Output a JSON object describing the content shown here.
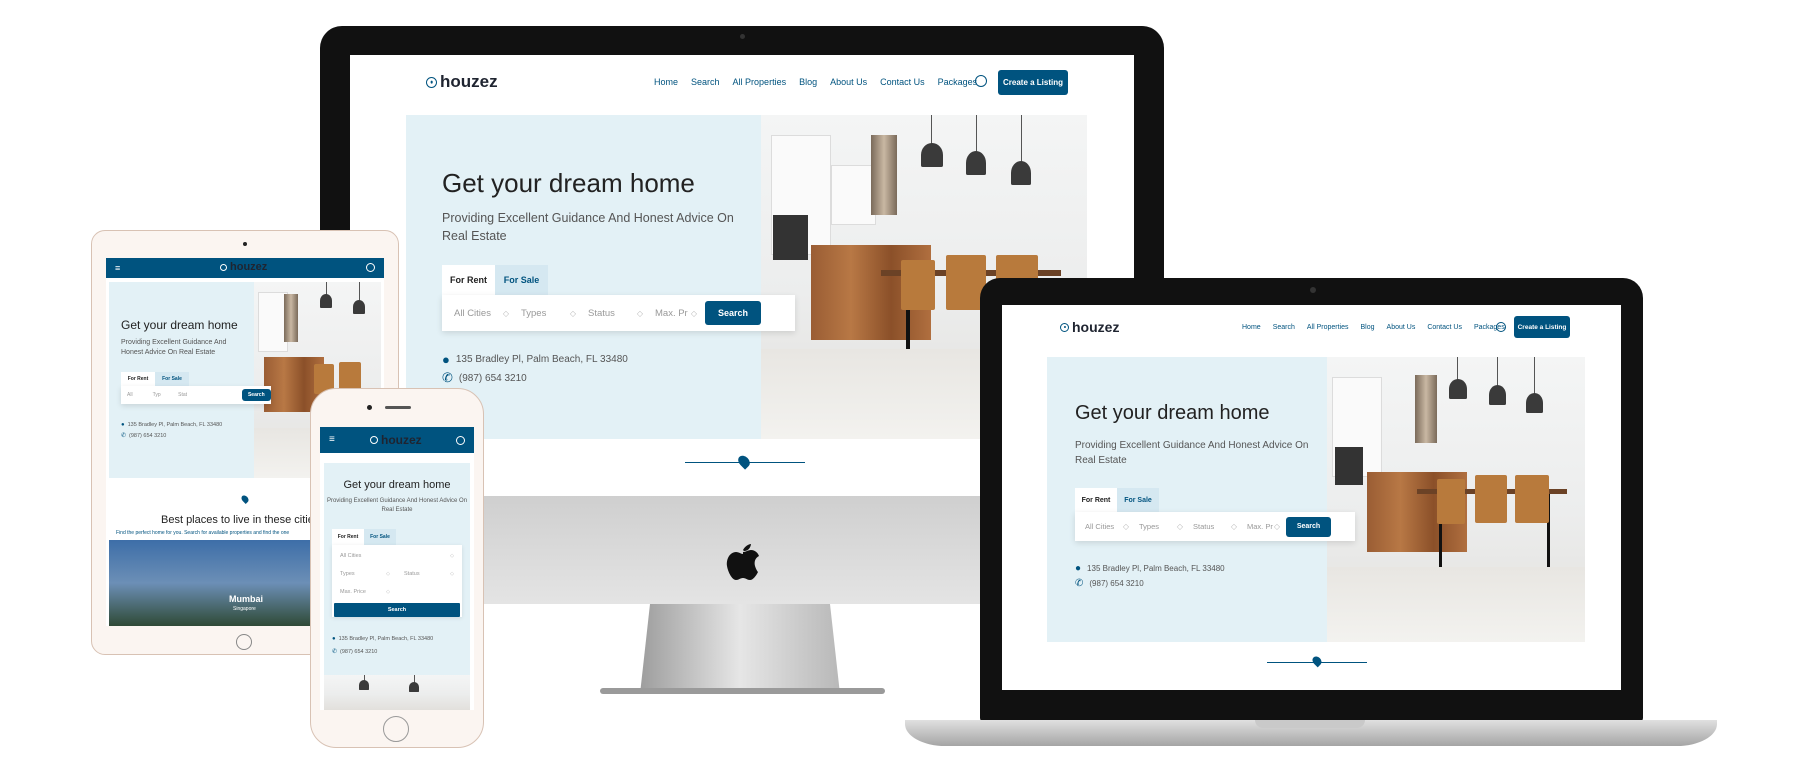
{
  "brand": "houzez",
  "nav": [
    "Home",
    "Search",
    "All Properties",
    "Blog",
    "About Us",
    "Contact Us",
    "Packages"
  ],
  "cta": "Create a Listing",
  "hero": {
    "title": "Get your dream home",
    "subtitle": "Providing Excellent Guidance And Honest Advice On Real Estate",
    "tabs": [
      "For Rent",
      "For Sale"
    ],
    "fields": [
      "All Cities",
      "Types",
      "Status",
      "Max. Pr"
    ],
    "fields_short": [
      "All",
      "Typ",
      "Stat"
    ],
    "fields_mobile": [
      "All Cities",
      "Types",
      "Status",
      "Max. Price"
    ],
    "search": "Search"
  },
  "contact": {
    "address": "135 Bradley Pl, Palm Beach, FL 33480",
    "phone": "(987) 654 3210"
  },
  "section_title": "Best places to live in these cities",
  "section_subtitle": "Find the perfect home for you. Search for available properties and find the one",
  "cities": [
    "Mumbai",
    "Singapore"
  ],
  "colors": {
    "primary": "#00537f",
    "hero_bg": "#e3f1f6"
  }
}
